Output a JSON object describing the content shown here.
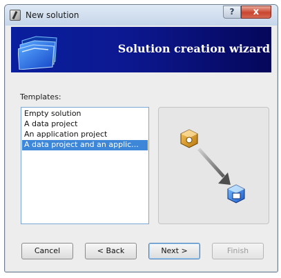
{
  "window": {
    "title": "New solution",
    "help_glyph": "?",
    "close_glyph": "x"
  },
  "banner": {
    "title": "Solution creation wizard",
    "icon": "folder-stack-icon"
  },
  "templates": {
    "label": "Templates:",
    "items": [
      "Empty solution",
      "A data project",
      "An application project",
      "A data project and an applic..."
    ],
    "selected_index": 3
  },
  "preview": {
    "icons": [
      "data-project-icon",
      "arrow-icon",
      "application-project-icon"
    ]
  },
  "buttons": {
    "cancel": "Cancel",
    "back": "< Back",
    "next": "Next >",
    "finish": "Finish"
  },
  "colors": {
    "banner_start": "#0a1f9e",
    "banner_end": "#05075a",
    "selection": "#3e86d8",
    "close_button": "#c9452e"
  }
}
